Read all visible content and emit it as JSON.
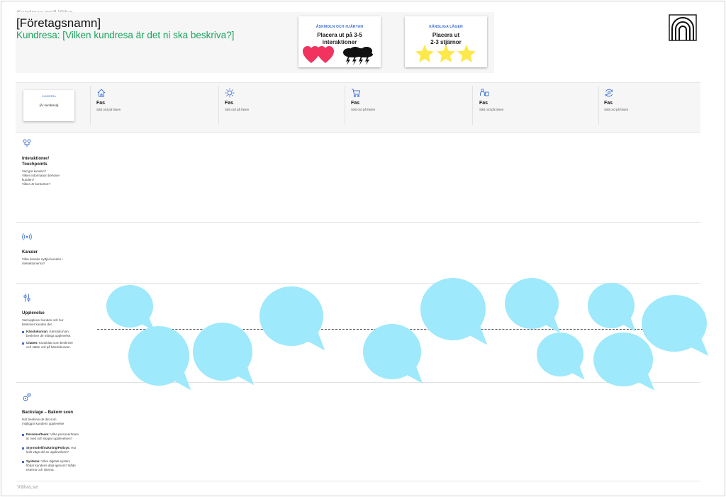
{
  "template_label": "Kundresa-mall Välva",
  "company_name": "[Företagsnamn]",
  "journey_title": "Kundresa: [Vilken kundresa är det ni ska beskriva?]",
  "cards": {
    "pain": {
      "title": "ÅSKMOLN OCH HJÄRTAN",
      "body_line1": "Placera ut på 3-5",
      "body_line2": "interaktioner",
      "icons": [
        "heart-icon",
        "heart-icon",
        "thundercloud-icon",
        "thundercloud-icon"
      ],
      "heart_color": "#f2335f"
    },
    "moments": {
      "title": "KÄNSLIGA LÄGEN",
      "body_line1": "Placera ut",
      "body_line2": "2-3 stjärnor",
      "icons": [
        "star-icon",
        "star-icon",
        "star-icon"
      ],
      "star_color": "#fde84a"
    }
  },
  "logo_icon": "arch-logo-icon",
  "customer_card": {
    "title": "KUNDRESA",
    "body": "[Är kundresa]"
  },
  "phases": [
    {
      "icon": "house-icon",
      "title": "Fas",
      "desc": "Sätt ord på fasen"
    },
    {
      "icon": "sun-icon",
      "title": "Fas",
      "desc": "Sätt ord på fasen"
    },
    {
      "icon": "cart-icon",
      "title": "Fas",
      "desc": "Sätt ord på fasen"
    },
    {
      "icon": "people-icon",
      "title": "Fas",
      "desc": "Sätt ord på fasen"
    },
    {
      "icon": "cycle-icon",
      "title": "Fas",
      "desc": "Sätt ord på fasen"
    }
  ],
  "rows": {
    "interactions": {
      "icon": "touchpoint-icon",
      "title_line1": "Interaktioner/",
      "title_line2": "Touchpoints",
      "desc": [
        "Vad gör kunden?",
        "Vilken information behöver",
        "kunden?",
        "Vilken är kontorton?"
      ]
    },
    "channels": {
      "icon": "broadcast-icon",
      "title": "Kanaler",
      "desc": [
        "Vilka kanaler nyttjar kunden i",
        "interaktionerna?"
      ]
    },
    "experience": {
      "icon": "sliders-icon",
      "title": "Upplevelse",
      "desc": [
        "Vad upplever kunden och hur",
        "beskriver kunden det."
      ],
      "bullets": [
        {
          "bold": "Känslokurvan:",
          "lines": [
            "Känslokurvan",
            "beskriver de många upplevelse."
          ]
        },
        {
          "bold": "Citaten:",
          "lines": [
            "Kundcitat som beskriver",
            "och sätter ord på känslokurvan."
          ]
        }
      ]
    },
    "backstage": {
      "icon": "gears-icon",
      "title": "Backstage – Bakom scen",
      "desc": [
        "Här beskrivs de det som",
        "möjliggör kundens upplevelse"
      ],
      "bullets": [
        {
          "bold": "Personer/team:",
          "lines": [
            "Vilka personer/team",
            "är med och skapar upplevelsen?"
          ]
        },
        {
          "bold": "Styrmodell/Sukining/Policys:",
          "lines": [
            "Hur",
            "leds vägs del av upplevelsen?"
          ]
        },
        {
          "bold": "Systems:",
          "lines": [
            "Vilka digitala system",
            "flödar kundens data igenom? Både",
            "externa och interna."
          ]
        }
      ]
    }
  },
  "speech_bubble_color": "#9ee9fb",
  "speech_bubble_count": 14,
  "footer": "Välva.se"
}
